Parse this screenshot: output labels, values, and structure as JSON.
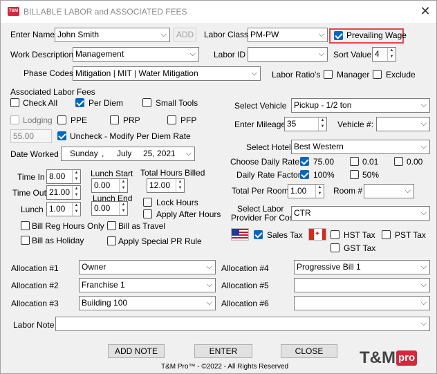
{
  "window": {
    "title": "BILLABLE LABOR and ASSOCIATED FEES",
    "app_icon_text": "T&M",
    "close_glyph": "✕"
  },
  "header": {
    "enter_name_label": "Enter Name",
    "name_value": "John Smith",
    "add_label": "ADD",
    "labor_class_label": "Labor Class",
    "labor_class_value": "PM-PW",
    "prevailing_wage_label": "Prevailing Wage",
    "prevailing_wage_checked": true,
    "work_description_label": "Work Description",
    "work_description_value": "Management",
    "labor_id_label": "Labor ID",
    "labor_id_value": "",
    "sort_value_label": "Sort Value",
    "sort_value": "4",
    "phase_codes_label": "Phase Codes",
    "phase_codes_value": "Mitigation | MIT | Water Mitigation",
    "labor_ratios_label": "Labor Ratio's",
    "manager_label": "Manager",
    "exclude_label": "Exclude"
  },
  "fees": {
    "title": "Associated Labor Fees",
    "check_all": "Check All",
    "per_diem": "Per Diem",
    "small_tools": "Small Tools",
    "lodging": "Lodging",
    "ppe": "PPE",
    "prp": "PRP",
    "pfp": "PFP",
    "per_diem_rate": "55.00",
    "uncheck_label": "Uncheck - Modify Per Diem Rate"
  },
  "date": {
    "label": "Date Worked",
    "weekday": "Sunday",
    "sep": ",",
    "month": "July",
    "day_year": "25, 2021"
  },
  "time": {
    "time_in_label": "Time In",
    "time_in": "8.00",
    "time_out_label": "Time Out",
    "time_out": "21.00",
    "lunch_label": "Lunch",
    "lunch": "1.00",
    "lunch_start_label": "Lunch Start",
    "lunch_start": "0.00",
    "lunch_end_label": "Lunch End",
    "lunch_end": "0.00",
    "total_hours_label": "Total Hours Billed",
    "total_hours": "12.00",
    "lock_hours": "Lock Hours",
    "apply_after_hours": "Apply After Hours",
    "bill_reg_hours_only": "Bill Reg Hours Only",
    "bill_as_travel": "Bill as Travel",
    "bill_as_holiday": "Bill as Holiday",
    "apply_special_pr": "Apply Special PR Rule"
  },
  "vehicle": {
    "select_vehicle_label": "Select Vehicle",
    "vehicle_value": "Pickup - 1/2 ton",
    "enter_mileage_label": "Enter Mileage",
    "mileage": "35",
    "vehicle_num_label": "Vehicle #:",
    "vehicle_num_value": ""
  },
  "hotel": {
    "select_hotel_label": "Select Hotel",
    "hotel_value": "Best Western",
    "choose_rate_label": "Choose Daily Rate",
    "rate1": "75.00",
    "rate2": "0.01",
    "rate3": "0.00",
    "rate_factor_label": "Daily Rate Factor",
    "factor1": "100%",
    "factor2": "50%",
    "total_per_room_label": "Total Per Room",
    "total_per_room": "1.00",
    "room_num_label": "Room #",
    "room_num_value": ""
  },
  "provider": {
    "label_line1": "Select Labor",
    "label_line2": "Provider For Cost",
    "value": "CTR"
  },
  "tax": {
    "sales_tax": "Sales Tax",
    "hst_tax": "HST Tax",
    "pst_tax": "PST Tax",
    "gst_tax": "GST Tax",
    "maple_glyph": "✦"
  },
  "allocations": [
    {
      "label": "Allocation #1",
      "value": "Owner"
    },
    {
      "label": "Allocation #2",
      "value": "Franchise 1"
    },
    {
      "label": "Allocation #3",
      "value": "Building 100"
    },
    {
      "label": "Allocation #4",
      "value": "Progressive Bill 1"
    },
    {
      "label": "Allocation #5",
      "value": ""
    },
    {
      "label": "Allocation #6",
      "value": ""
    }
  ],
  "labor_note": {
    "label": "Labor Note",
    "value": ""
  },
  "buttons": {
    "add_note": "ADD NOTE",
    "enter": "ENTER",
    "close": "CLOSE"
  },
  "footer": {
    "copyright": "T&M Pro™ - ©2022 - All Rights Reserved",
    "logo_tm": "T&M",
    "logo_pro": "pro"
  },
  "icons": {
    "chevron": "chevron-down-icon",
    "spinner": "spinner-arrows-icon"
  },
  "colors": {
    "accent": "#0067c0",
    "highlight": "#e04848",
    "brand": "#d7263d"
  }
}
